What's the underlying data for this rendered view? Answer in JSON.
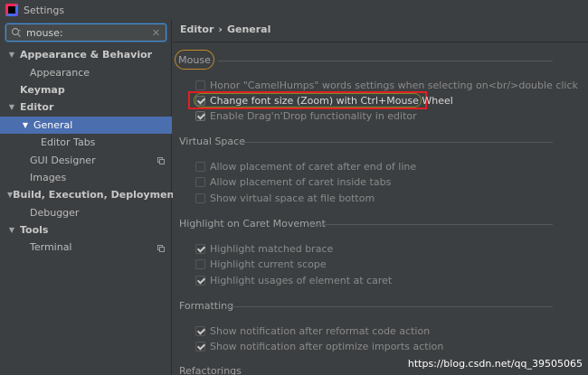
{
  "window": {
    "title": "Settings"
  },
  "search": {
    "value": "mouse:"
  },
  "tree": [
    {
      "label": "Appearance & Behavior",
      "level": 0,
      "arrow": "▼",
      "bold": true
    },
    {
      "label": "Appearance",
      "level": 1,
      "arrow": "",
      "bold": false
    },
    {
      "label": "Keymap",
      "level": 0,
      "arrow": "",
      "bold": true
    },
    {
      "label": "Editor",
      "level": 0,
      "arrow": "▼",
      "bold": true
    },
    {
      "label": "General",
      "level": 1,
      "arrow": "▼",
      "bold": false,
      "selected": true
    },
    {
      "label": "Editor Tabs",
      "level": 2,
      "arrow": "",
      "bold": false
    },
    {
      "label": "GUI Designer",
      "level": 1,
      "arrow": "",
      "bold": false,
      "copy": true
    },
    {
      "label": "Images",
      "level": 1,
      "arrow": "",
      "bold": false
    },
    {
      "label": "Build, Execution, Deployment",
      "level": 0,
      "arrow": "▼",
      "bold": true
    },
    {
      "label": "Debugger",
      "level": 1,
      "arrow": "",
      "bold": false
    },
    {
      "label": "Tools",
      "level": 0,
      "arrow": "▼",
      "bold": true
    },
    {
      "label": "Terminal",
      "level": 1,
      "arrow": "",
      "bold": false,
      "copy": true
    }
  ],
  "breadcrumb": {
    "first": "Editor",
    "sep": "›",
    "second": "General"
  },
  "sections": {
    "mouse": {
      "title": "Mouse",
      "options": [
        {
          "label": "Honor \"CamelHumps\" words settings when selecting on<br/>double click",
          "checked": false,
          "disabled": true
        },
        {
          "label": "Change font size (Zoom) with Ctrl+Mouse Wheel",
          "checked": true,
          "disabled": false
        },
        {
          "label": "Enable Drag'n'Drop functionality in editor",
          "checked": true,
          "disabled": false
        }
      ]
    },
    "virtual_space": {
      "title": "Virtual Space",
      "options": [
        {
          "label": "Allow placement of caret after end of line",
          "checked": false,
          "disabled": true
        },
        {
          "label": "Allow placement of caret inside tabs",
          "checked": false,
          "disabled": true
        },
        {
          "label": "Show virtual space at file bottom",
          "checked": false,
          "disabled": true
        }
      ]
    },
    "caret": {
      "title": "Highlight on Caret Movement",
      "options": [
        {
          "label": "Highlight matched brace",
          "checked": true,
          "disabled": true
        },
        {
          "label": "Highlight current scope",
          "checked": false,
          "disabled": true
        },
        {
          "label": "Highlight usages of element at caret",
          "checked": true,
          "disabled": true
        }
      ]
    },
    "formatting": {
      "title": "Formatting",
      "options": [
        {
          "label": "Show notification after reformat code action",
          "checked": true,
          "disabled": true
        },
        {
          "label": "Show notification after optimize imports action",
          "checked": true,
          "disabled": true
        }
      ]
    },
    "refactorings": {
      "title": "Refactorings"
    }
  },
  "watermark": "https://blog.csdn.net/qq_39505065",
  "colors": {
    "selected_bg": "#4b6eaf",
    "highlight_red": "#e02020",
    "mouse_circle": "#c08a2a"
  }
}
